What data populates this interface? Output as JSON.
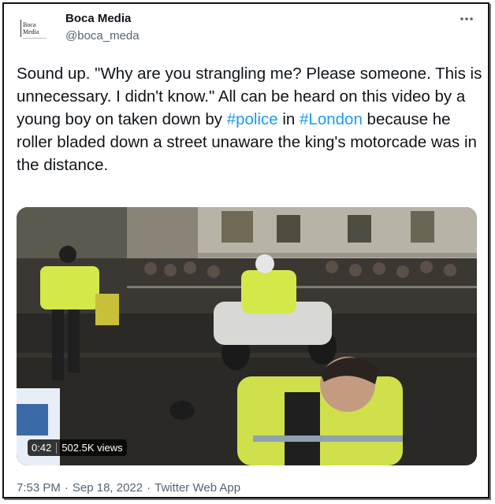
{
  "author": {
    "display_name": "Boca Media",
    "handle": "@boca_meda",
    "avatar_text": [
      "Boca",
      "Media"
    ]
  },
  "tweet": {
    "text_before": "Sound up. \"Why are you strangling me? Please someone. This is unnecessary. I didn't know.\" All can be heard on this video by a young boy on taken down by ",
    "hashtag1": "#police",
    "text_between": " in ",
    "hashtag2": "#London",
    "text_after": " because he roller bladed down a street unaware the king's motorcade was in the distance."
  },
  "video": {
    "duration": "0:42",
    "views": "502.5K views"
  },
  "meta": {
    "time": "7:53 PM",
    "separator": "·",
    "date": "Sep 18, 2022",
    "source": "Twitter Web App"
  },
  "icons": {
    "more": "more-dots-icon"
  },
  "colors": {
    "hashtag": "#1d9bf0",
    "secondary_text": "#536471",
    "hi_vis": "#d4e84a"
  }
}
